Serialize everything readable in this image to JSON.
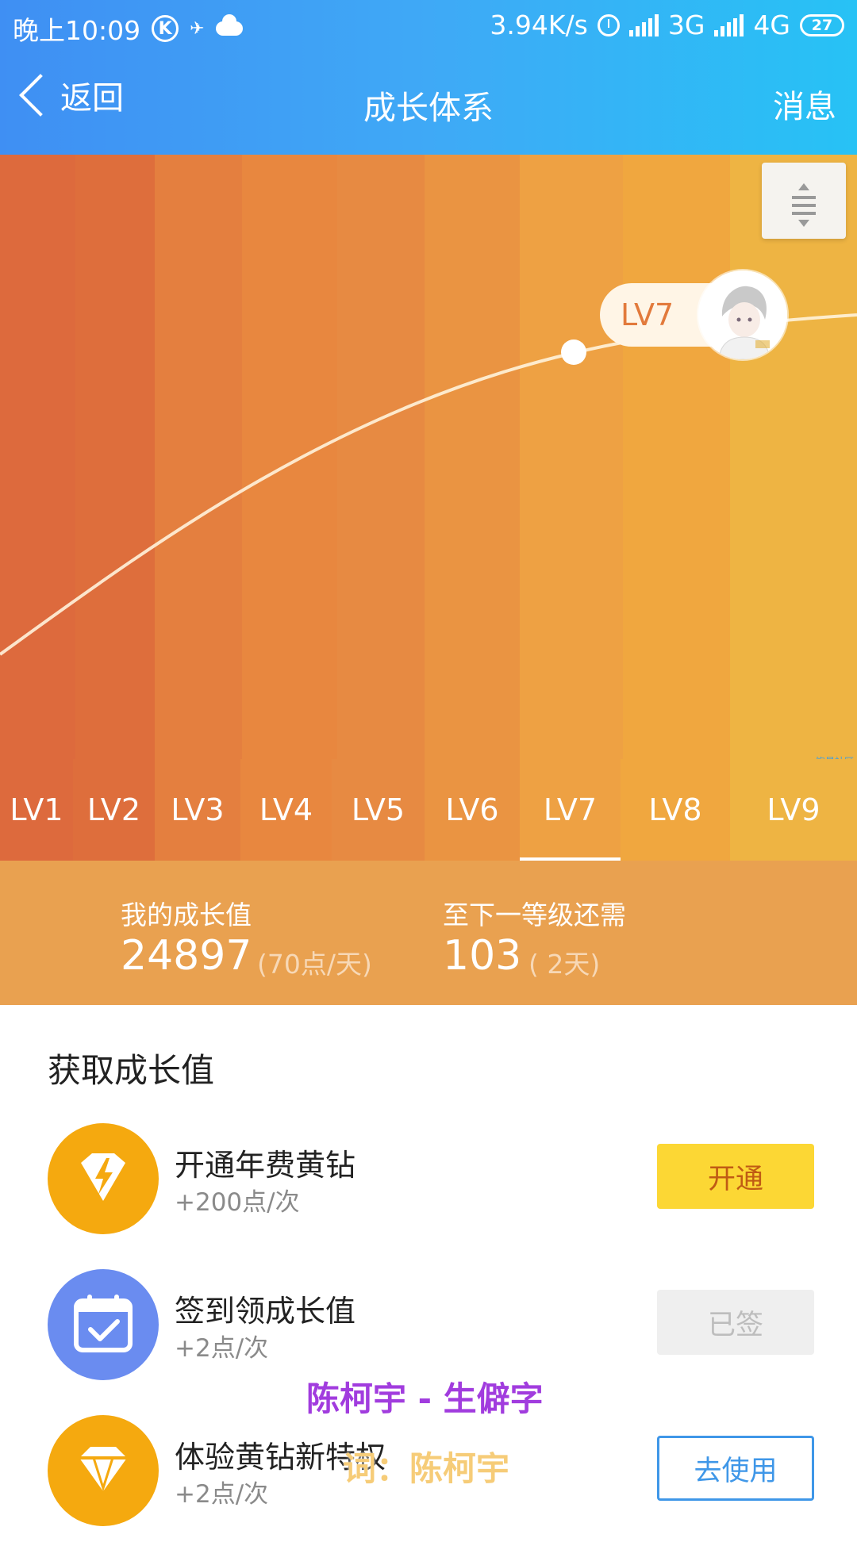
{
  "status_bar": {
    "time": "晚上10:09",
    "speed": "3.94K/s",
    "net_3g": "3G",
    "net_4g": "4G",
    "battery": "27"
  },
  "nav": {
    "back_label": "返回",
    "title": "成长体系",
    "messages_label": "消息"
  },
  "hero": {
    "current_level_badge": "LV7",
    "watermark": "饱星社区",
    "levels": [
      "LV1",
      "LV2",
      "LV3",
      "LV4",
      "LV5",
      "LV6",
      "LV7",
      "LV8",
      "LV9"
    ],
    "active_level": "LV7"
  },
  "stats": {
    "growth_label": "我的成长值",
    "growth_value": "24897",
    "growth_rate": "(70点/天)",
    "next_label": "至下一等级还需",
    "next_value": "103",
    "next_days": "( 2天)"
  },
  "earn": {
    "title": "获取成长值",
    "tasks": [
      {
        "name": "开通年费黄钻",
        "points": "+200点/次",
        "button": "开通",
        "icon": "lightning-diamond-icon",
        "icon_color": "#f5a90f"
      },
      {
        "name": "签到领成长值",
        "points": "+2点/次",
        "button": "已签",
        "icon": "calendar-check-icon",
        "icon_color": "#6a8cf0"
      },
      {
        "name": "体验黄钻新特权",
        "points": "+2点/次",
        "button": "去使用",
        "icon": "diamond-icon",
        "icon_color": "#f5a90f"
      }
    ]
  },
  "overlay": {
    "lyric_line1": "陈柯宇 - 生僻字",
    "lyric_line2": "词：陈柯宇"
  },
  "colors": {
    "header_blue": "#3fa9f6",
    "hero_orange": "#ee9a3d",
    "stats_orange": "#e9a150",
    "button_yellow": "#fcd734",
    "button_blue": "#3f97e8"
  }
}
